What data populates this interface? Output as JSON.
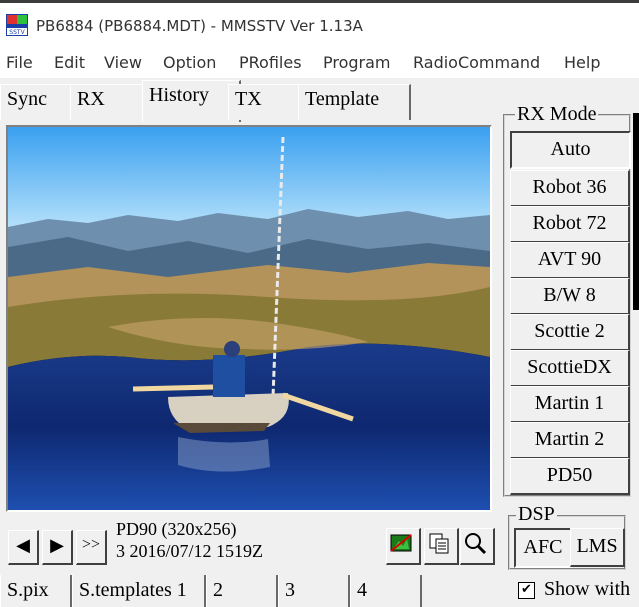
{
  "window": {
    "title": "PB6884 (PB6884.MDT) - MMSSTV Ver 1.13A",
    "app_icon_text": "SSTV"
  },
  "menu": [
    "File",
    "Edit",
    "View",
    "Option",
    "PRofiles",
    "Program",
    "RadioCommand",
    "Help"
  ],
  "tabs": [
    "Sync",
    "RX",
    "History",
    "TX",
    "Template"
  ],
  "active_tab": "History",
  "history": {
    "mode_info": "PD90 (320x256)",
    "entry_info": "3 2016/07/12 1519Z",
    "nav": {
      "prev": "◀",
      "next": "▶",
      "last": ">>"
    }
  },
  "rx_mode": {
    "label": "RX Mode",
    "buttons": [
      "Auto",
      "Robot 36",
      "Robot 72",
      "AVT 90",
      "B/W 8",
      "Scottie 2",
      "ScottieDX",
      "Martin 1",
      "Martin 2",
      "PD50"
    ],
    "selected": "Auto"
  },
  "dsp": {
    "label": "DSP",
    "buttons": [
      "AFC",
      "LMS"
    ],
    "selected": "AFC"
  },
  "bottom_tabs": [
    "S.pix",
    "S.templates 1",
    "2",
    "3",
    "4"
  ],
  "show_with": {
    "label": "Show with",
    "checked_glyph": "✔"
  }
}
